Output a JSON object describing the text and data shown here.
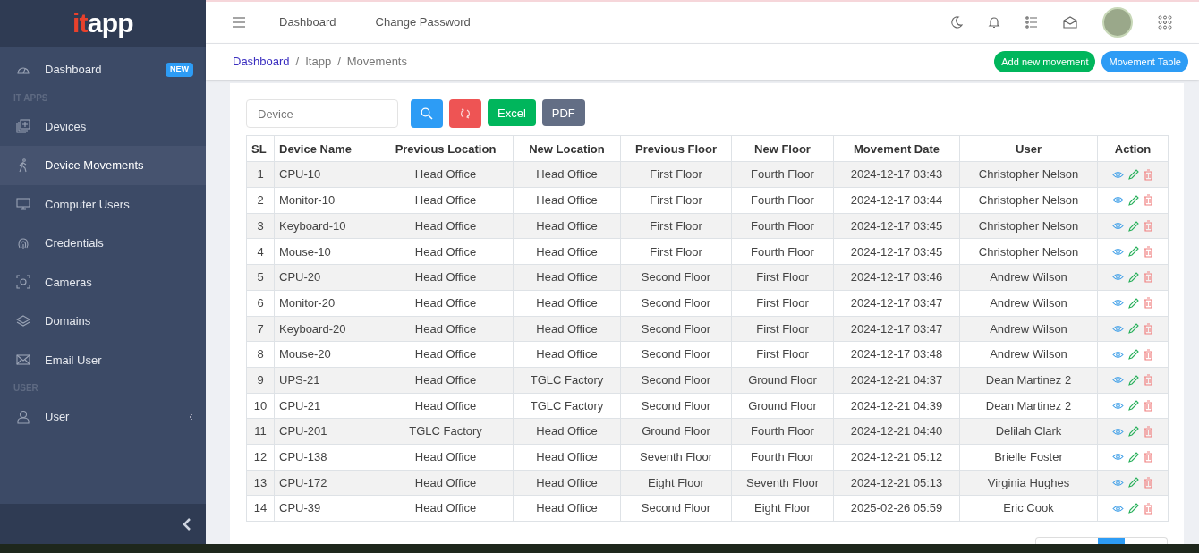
{
  "logo": [
    {
      "text": "it",
      "color": "#e8412c"
    },
    {
      "text": "app",
      "color": "#ffffff"
    }
  ],
  "sidebar": {
    "items": [
      {
        "kind": "item",
        "label": "Dashboard",
        "badge": "NEW",
        "selected": false
      },
      {
        "kind": "section",
        "label": "IT APPS"
      },
      {
        "kind": "item",
        "label": "Devices",
        "selected": false
      },
      {
        "kind": "item",
        "label": "Device Movements",
        "selected": true
      },
      {
        "kind": "item",
        "label": "Computer Users",
        "selected": false
      },
      {
        "kind": "item",
        "label": "Credentials",
        "selected": false
      },
      {
        "kind": "item",
        "label": "Cameras",
        "selected": false
      },
      {
        "kind": "item",
        "label": "Domains",
        "selected": false
      },
      {
        "kind": "item",
        "label": "Email User",
        "selected": false
      },
      {
        "kind": "section",
        "label": "USER"
      },
      {
        "kind": "item",
        "label": "User",
        "selected": false,
        "expandable": true
      }
    ]
  },
  "topbar": {
    "links": [
      "Dashboard",
      "Change Password"
    ]
  },
  "breadcrumb": {
    "separator": "/",
    "items": [
      "Dashboard",
      "Itapp",
      "Movements"
    ]
  },
  "actions": [
    {
      "label": "Add new movement",
      "color": "#00b65c"
    },
    {
      "label": "Movement Table",
      "color": "#2d9cf5"
    }
  ],
  "filter": {
    "placeholder": "Device",
    "buttons": [
      {
        "kind": "search",
        "color": "#2d9cf5"
      },
      {
        "kind": "reset",
        "color": "#ee5454"
      },
      {
        "kind": "text",
        "label": "Excel",
        "color": "#00b65c"
      },
      {
        "kind": "text",
        "label": "PDF",
        "color": "#636e85"
      }
    ]
  },
  "table": {
    "columns": [
      "SL",
      "Device Name",
      "Previous Location",
      "New Location",
      "Previous Floor",
      "New Floor",
      "Movement Date",
      "User",
      "Action"
    ],
    "rows": [
      [
        "1",
        "CPU-10",
        "Head Office",
        "Head Office",
        "First Floor",
        "Fourth Floor",
        "2024-12-17 03:43",
        "Christopher Nelson"
      ],
      [
        "2",
        "Monitor-10",
        "Head Office",
        "Head Office",
        "First Floor",
        "Fourth Floor",
        "2024-12-17 03:44",
        "Christopher Nelson"
      ],
      [
        "3",
        "Keyboard-10",
        "Head Office",
        "Head Office",
        "First Floor",
        "Fourth Floor",
        "2024-12-17 03:45",
        "Christopher Nelson"
      ],
      [
        "4",
        "Mouse-10",
        "Head Office",
        "Head Office",
        "First Floor",
        "Fourth Floor",
        "2024-12-17 03:45",
        "Christopher Nelson"
      ],
      [
        "5",
        "CPU-20",
        "Head Office",
        "Head Office",
        "Second Floor",
        "First Floor",
        "2024-12-17 03:46",
        "Andrew Wilson"
      ],
      [
        "6",
        "Monitor-20",
        "Head Office",
        "Head Office",
        "Second Floor",
        "First Floor",
        "2024-12-17 03:47",
        "Andrew Wilson"
      ],
      [
        "7",
        "Keyboard-20",
        "Head Office",
        "Head Office",
        "Second Floor",
        "First Floor",
        "2024-12-17 03:47",
        "Andrew Wilson"
      ],
      [
        "8",
        "Mouse-20",
        "Head Office",
        "Head Office",
        "Second Floor",
        "First Floor",
        "2024-12-17 03:48",
        "Andrew Wilson"
      ],
      [
        "9",
        "UPS-21",
        "Head Office",
        "TGLC Factory",
        "Second Floor",
        "Ground Floor",
        "2024-12-21 04:37",
        "Dean Martinez 2"
      ],
      [
        "10",
        "CPU-21",
        "Head Office",
        "TGLC Factory",
        "Second Floor",
        "Ground Floor",
        "2024-12-21 04:39",
        "Dean Martinez 2"
      ],
      [
        "11",
        "CPU-201",
        "TGLC Factory",
        "Head Office",
        "Ground Floor",
        "Fourth Floor",
        "2024-12-21 04:40",
        "Delilah Clark"
      ],
      [
        "12",
        "CPU-138",
        "Head Office",
        "Head Office",
        "Seventh Floor",
        "Fourth Floor",
        "2024-12-21 05:12",
        "Brielle Foster"
      ],
      [
        "13",
        "CPU-172",
        "Head Office",
        "Head Office",
        "Eight Floor",
        "Seventh Floor",
        "2024-12-21 05:13",
        "Virginia Hughes"
      ],
      [
        "14",
        "CPU-39",
        "Head Office",
        "Head Office",
        "Second Floor",
        "Eight Floor",
        "2025-02-26 05:59",
        "Eric Cook"
      ]
    ]
  }
}
